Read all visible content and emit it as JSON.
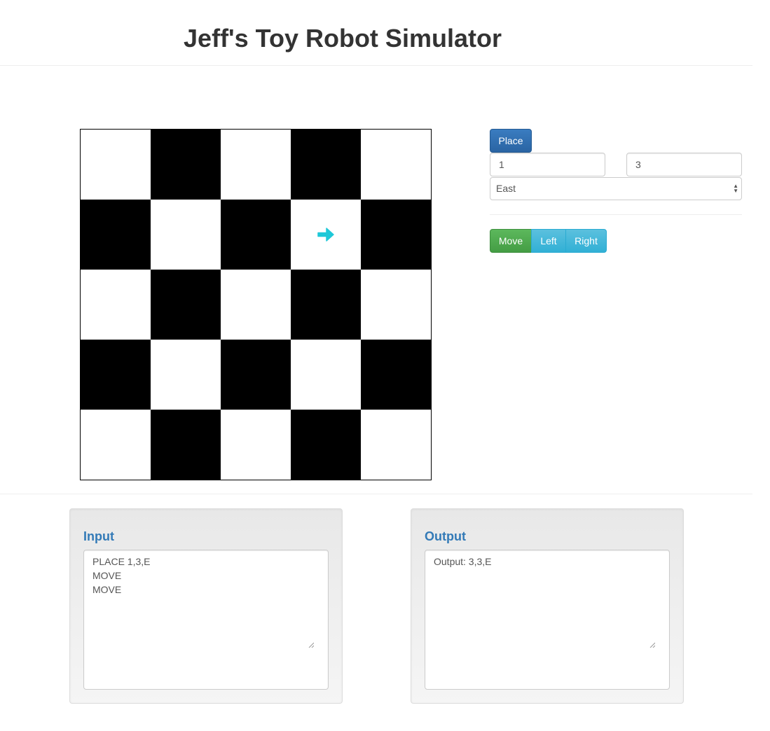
{
  "header": {
    "title": "Jeff's Toy Robot Simulator"
  },
  "board": {
    "size": 5,
    "robot": {
      "column": 4,
      "row": 2,
      "facing": "East"
    },
    "colors": {
      "dark": "#000000",
      "light": "#ffffff",
      "robot": "#1fc8d8"
    }
  },
  "controls": {
    "place_label": "Place",
    "x_value": "1",
    "y_value": "3",
    "direction_selected": "East",
    "move_label": "Move",
    "left_label": "Left",
    "right_label": "Right"
  },
  "input_panel": {
    "title": "Input",
    "text": "PLACE 1,3,E\nMOVE\nMOVE"
  },
  "output_panel": {
    "title": "Output",
    "text": "Output: 3,3,E"
  }
}
